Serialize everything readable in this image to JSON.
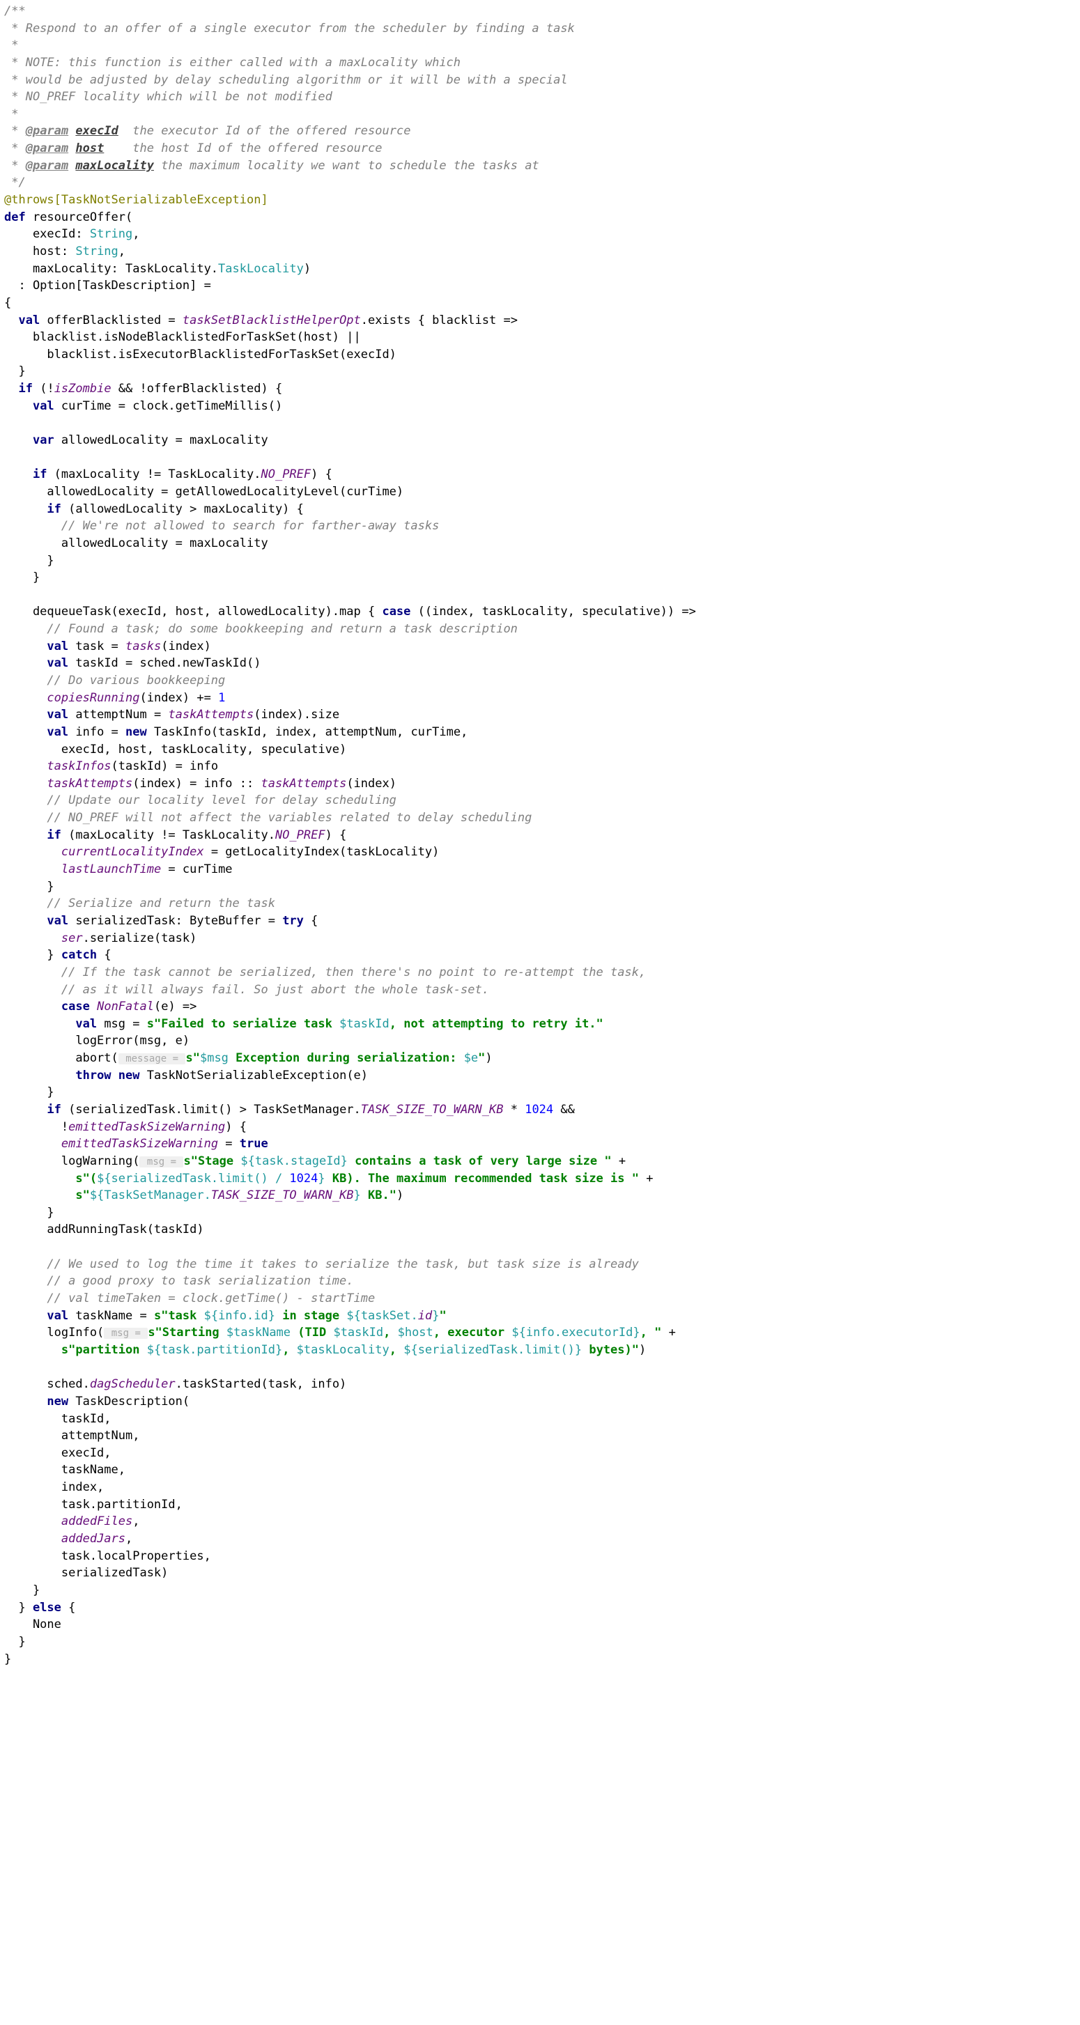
{
  "doc": {
    "l1": "/**",
    "l2": " * Respond to an offer of a single executor from the scheduler by finding a task",
    "l3": " *",
    "l4": " * NOTE: this function is either called with a maxLocality which",
    "l5": " * would be adjusted by delay scheduling algorithm or it will be with a special",
    "l6": " * NO_PREF locality which will be not modified",
    "l7": " *",
    "p1tag": "@param",
    "p1name": "execId",
    "p1rest": "  the executor Id of the offered resource",
    "p2tag": "@param",
    "p2name": "host",
    "p2rest": "    the host Id of the offered resource",
    "p3tag": "@param",
    "p3name": "maxLocality",
    "p3rest": " the maximum locality we want to schedule the tasks at",
    "lend": " */"
  },
  "ann": "@throws[TaskNotSerializableException]",
  "sig": {
    "def": "def",
    "name": " resourceOffer(",
    "p1a": "    execId: ",
    "p1t": "String",
    "p1c": ",",
    "p2a": "    host: ",
    "p2t": "String",
    "p2c": ",",
    "p3a": "    maxLocality: TaskLocality.",
    "p3t": "TaskLocality",
    "p3c": ")",
    "ret": "  : Option[TaskDescription] =",
    "open": "{"
  },
  "b": {
    "val": "val",
    "var": "var",
    "if": "if",
    "else": "else",
    "new": "new",
    "case": "case",
    "try": "try",
    "catch": "catch",
    "throw": "throw",
    "true": "true",
    "l1a": " offerBlacklisted = ",
    "l1f": "taskSetBlacklistHelperOpt",
    "l1b": ".exists { blacklist =>",
    "l2": "    blacklist.isNodeBlacklistedForTaskSet(host) ||",
    "l3": "      blacklist.isExecutorBlacklistedForTaskSet(execId)",
    "l4": "  }",
    "l5a": " (!",
    "l5f": "isZombie",
    "l5b": " && !offerBlacklisted) {",
    "l6": " curTime = clock.getTimeMillis()",
    "l7": " allowedLocality = maxLocality",
    "l8a": " (maxLocality != TaskLocality.",
    "l8f": "NO_PREF",
    "l8b": ") {",
    "l9": "      allowedLocality = getAllowedLocalityLevel(curTime)",
    "l10a": " (allowedLocality > maxLocality) {",
    "l11": "        // We're not allowed to search for farther-away tasks",
    "l12": "        allowedLocality = maxLocality",
    "l13": "      }",
    "l14": "    }",
    "l15a": "    dequeueTask(execId, host, allowedLocality).map { ",
    "l15b": " ((index, taskLocality, speculative)) =>",
    "l16": "      // Found a task; do some bookkeeping and return a task description",
    "l17a": " task = ",
    "l17f": "tasks",
    "l17b": "(index)",
    "l18": " taskId = sched.newTaskId()",
    "l19": "      // Do various bookkeeping",
    "l20f": "copiesRunning",
    "l20a": "(index) += ",
    "l20n": "1",
    "l21a": " attemptNum = ",
    "l21f": "taskAttempts",
    "l21b": "(index).size",
    "l22a": " info = ",
    "l22b": " TaskInfo(taskId, index, attemptNum, curTime,",
    "l23": "        execId, host, taskLocality, speculative)",
    "l24f": "taskInfos",
    "l24a": "(taskId) = info",
    "l25f1": "taskAttempts",
    "l25a": "(index) = info :: ",
    "l25f2": "taskAttempts",
    "l25b": "(index)",
    "l26": "      // Update our locality level for delay scheduling",
    "l27": "      // NO_PREF will not affect the variables related to delay scheduling",
    "l28a": " (maxLocality != TaskLocality.",
    "l28f": "NO_PREF",
    "l28b": ") {",
    "l29f": "currentLocalityIndex",
    "l29a": " = getLocalityIndex(taskLocality)",
    "l30f": "lastLaunchTime",
    "l30a": " = curTime",
    "l31": "      }",
    "l32": "      // Serialize and return the task",
    "l33a": " serializedTask: ByteBuffer = ",
    "l33b": " {",
    "l34f": "ser",
    "l34a": ".serialize(task)",
    "l35": "      } ",
    "l35b": " {",
    "l36": "        // If the task cannot be serialized, then there's no point to re-attempt the task,",
    "l37": "        // as it will always fail. So just abort the whole task-set.",
    "l38a": "        ",
    "l38f": "NonFatal",
    "l38b": "(e) =>",
    "l39a": " msg = ",
    "l39s1": "s\"Failed to serialize task ",
    "l39v": "$taskId",
    "l39s2": ", not attempting to retry it.\"",
    "l40": "          logError(msg, e)",
    "l41a": "          abort(",
    "l41h": " message = ",
    "l41s1": "s\"",
    "l41v1": "$msg",
    "l41s2": " Exception during serialization: ",
    "l41v2": "$e",
    "l41s3": "\"",
    "l41b": ")",
    "l42a": "          ",
    "l42b": " ",
    "l42c": " TaskNotSerializableException(e)",
    "l43": "      }",
    "l44a": " (serializedTask.limit() > TaskSetManager.",
    "l44f": "TASK_SIZE_TO_WARN_KB",
    "l44b": " * ",
    "l44n": "1024",
    "l44c": " &&",
    "l45a": "        !",
    "l45f": "emittedTaskSizeWarning",
    "l45b": ") {",
    "l46f": "emittedTaskSizeWarning",
    "l46a": " = ",
    "l47a": "        logWarning(",
    "l47h": " msg = ",
    "l47s1": "s\"Stage ",
    "l47v1": "${task.stageId}",
    "l47s2": " contains a task of very large size \"",
    "l47b": " +",
    "l48s1": "s\"(",
    "l48v1": "${serializedTask.limit() / ",
    "l48n": "1024",
    "l48v1b": "}",
    "l48s2": " KB). The maximum recommended task size is \"",
    "l48b": " +",
    "l49s1": "s\"",
    "l49v1": "${TaskSetManager.",
    "l49f": "TASK_SIZE_TO_WARN_KB",
    "l49v1b": "}",
    "l49s2": " KB.\"",
    "l49b": ")",
    "l50": "      }",
    "l51": "      addRunningTask(taskId)",
    "l52": "      // We used to log the time it takes to serialize the task, but task size is already",
    "l53": "      // a good proxy to task serialization time.",
    "l54": "      // val timeTaken = clock.getTime() - startTime",
    "l55a": " taskName = ",
    "l55s1": "s\"task ",
    "l55v1": "${info.id}",
    "l55s2": " in stage ",
    "l55v2": "${taskSet.",
    "l55f": "id",
    "l55v2b": "}",
    "l55s3": "\"",
    "l56a": "      logInfo(",
    "l56h": " msg = ",
    "l56s1": "s\"Starting ",
    "l56v1": "$taskName",
    "l56s2": " (TID ",
    "l56v2": "$taskId",
    "l56s3": ", ",
    "l56v3": "$host",
    "l56s4": ", executor ",
    "l56v4": "${info.executorId}",
    "l56s5": ", \"",
    "l56b": " +",
    "l57s1": "s\"partition ",
    "l57v1": "${task.partitionId}",
    "l57s2": ", ",
    "l57v2": "$taskLocality",
    "l57s3": ", ",
    "l57v3": "${serializedTask.limit()}",
    "l57s4": " bytes)\"",
    "l57b": ")",
    "l58a": "      sched.",
    "l58f": "dagScheduler",
    "l58b": ".taskStarted(task, info)",
    "l59a": "      ",
    "l59b": " TaskDescription(",
    "l60": "        taskId,",
    "l61": "        attemptNum,",
    "l62": "        execId,",
    "l63": "        taskName,",
    "l64": "        index,",
    "l65": "        task.partitionId,",
    "l66f": "addedFiles",
    "l66a": ",",
    "l67f": "addedJars",
    "l67a": ",",
    "l68": "        task.localProperties,",
    "l69": "        serializedTask)",
    "l70": "    }",
    "l71": "  } ",
    "l71b": " {",
    "l72": "    None",
    "l73": "  }",
    "l74": "}"
  }
}
